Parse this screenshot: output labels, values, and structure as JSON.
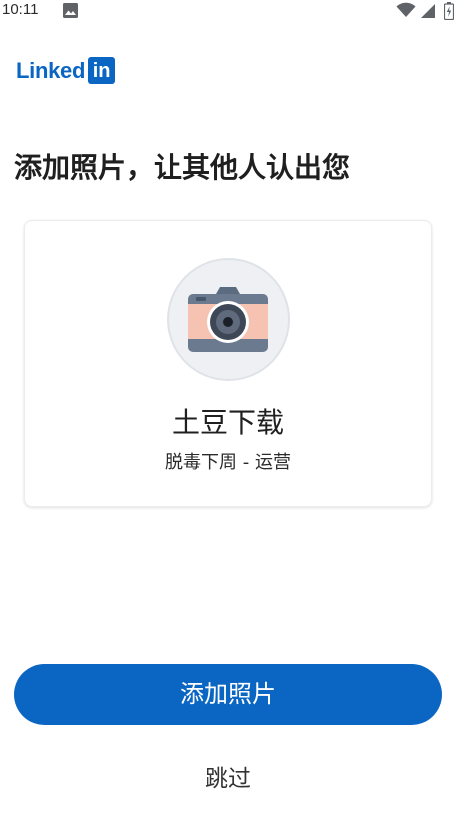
{
  "status_bar": {
    "time": "10:11",
    "icons": [
      "image-icon",
      "wifi-icon",
      "signal-icon",
      "battery-icon"
    ]
  },
  "logo": {
    "word": "Linked",
    "box": "in",
    "brand_color": "#0a66c2"
  },
  "title": "添加照片，让其他人认出您",
  "card": {
    "avatar_icon": "camera-icon",
    "name": "土豆下载",
    "subtitle": "脱毒下周 - 运营"
  },
  "actions": {
    "add_photo_label": "添加照片",
    "skip_label": "跳过"
  }
}
